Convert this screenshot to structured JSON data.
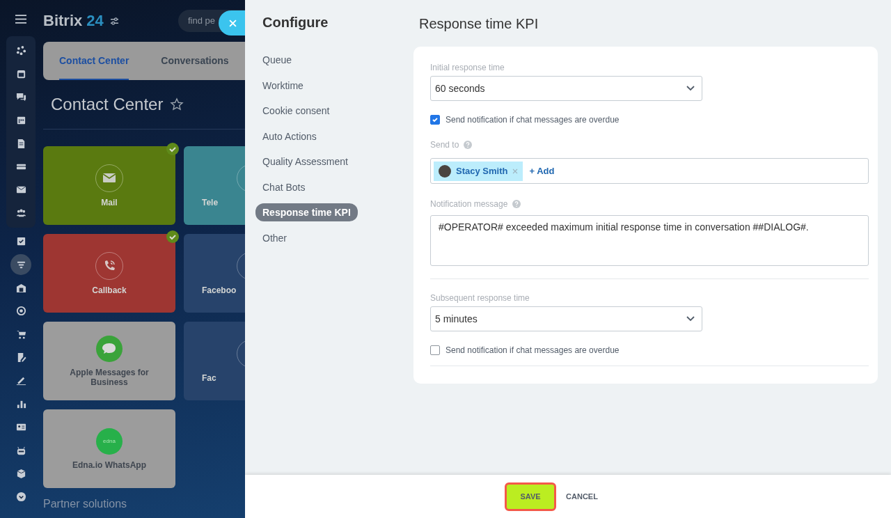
{
  "app_header": {
    "logo_word": "Bitrix",
    "logo_number": "24",
    "search_placeholder": "find pe"
  },
  "nav_rail": {
    "pinned": [
      {
        "selected": false
      },
      {
        "selected": false
      },
      {
        "selected": false
      },
      {
        "selected": false
      },
      {
        "selected": false
      },
      {
        "selected": false
      },
      {
        "selected": false
      },
      {
        "selected": false
      }
    ],
    "items": [
      {
        "selected": false
      },
      {
        "selected": true
      },
      {
        "selected": false
      },
      {
        "selected": false
      },
      {
        "selected": false
      },
      {
        "selected": false
      },
      {
        "selected": false
      },
      {
        "selected": false
      },
      {
        "selected": false
      },
      {
        "selected": false
      },
      {
        "selected": false
      },
      {
        "selected": false
      }
    ]
  },
  "page_tabs": [
    {
      "label": "Contact Center",
      "selected": true
    },
    {
      "label": "Conversations",
      "selected": false
    }
  ],
  "page_title": "Contact Center",
  "tiles": [
    {
      "label": "Mail",
      "kind": "mail",
      "color": "#5a7a10",
      "checked": true
    },
    {
      "label": "Tele",
      "kind": "partial",
      "color": "#3a8590",
      "checked": false
    },
    {
      "label": "Callback",
      "kind": "phone",
      "color": "#9e3632",
      "checked": true
    },
    {
      "label": "Faceboo",
      "kind": "partial",
      "color": "#27436b",
      "checked": false
    },
    {
      "label": "Apple Messages for Business",
      "kind": "chat",
      "color": "#9c9c9c",
      "checked": false
    },
    {
      "label": "Fac",
      "kind": "partial",
      "color": "#27436b",
      "checked": false
    },
    {
      "label": "Edna.io WhatsApp",
      "kind": "edna",
      "color": "#9c9c9c",
      "checked": false,
      "logo_text": "edna"
    }
  ],
  "section_heading": "Partner solutions",
  "configure": {
    "title": "Configure",
    "menu": [
      {
        "label": "Queue",
        "selected": false
      },
      {
        "label": "Worktime",
        "selected": false
      },
      {
        "label": "Cookie consent",
        "selected": false
      },
      {
        "label": "Auto Actions",
        "selected": false
      },
      {
        "label": "Quality Assessment",
        "selected": false
      },
      {
        "label": "Chat Bots",
        "selected": false
      },
      {
        "label": "Response time KPI",
        "selected": true
      },
      {
        "label": "Other",
        "selected": false
      }
    ]
  },
  "kpi": {
    "title": "Response time KPI",
    "initial": {
      "label": "Initial response time",
      "value": "60 seconds"
    },
    "initial_notify": {
      "label": "Send notification if chat messages are overdue",
      "checked": true
    },
    "send_to": {
      "label": "Send to",
      "recipients": [
        {
          "name": "Stacy Smith"
        }
      ],
      "add_label": "+ Add"
    },
    "notification_message": {
      "label": "Notification message",
      "value": "#OPERATOR# exceeded maximum initial response time in conversation ##DIALOG#."
    },
    "subsequent": {
      "label": "Subsequent response time",
      "value": "5 minutes"
    },
    "subsequent_notify": {
      "label": "Send notification if chat messages are overdue",
      "checked": false
    }
  },
  "footer": {
    "save": "SAVE",
    "cancel": "CANCEL"
  }
}
